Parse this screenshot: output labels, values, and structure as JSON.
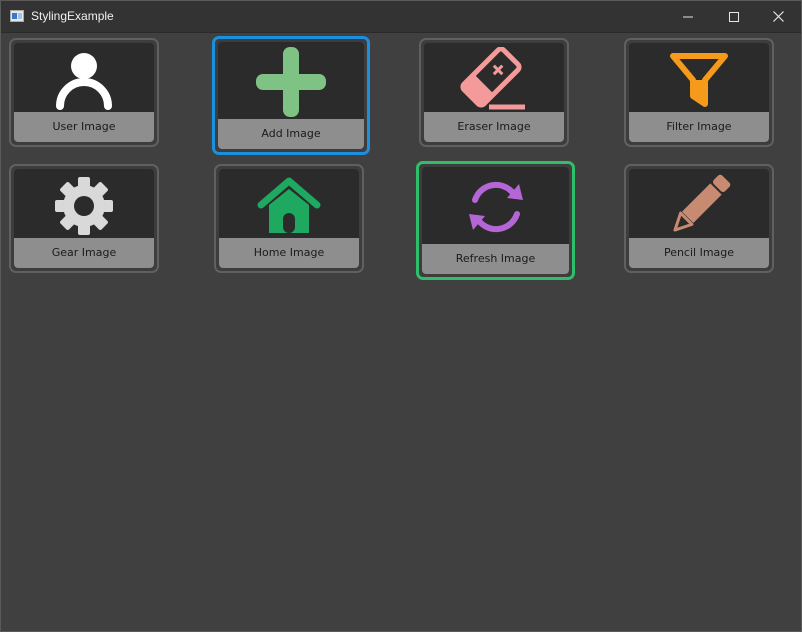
{
  "window": {
    "title": "StylingExample"
  },
  "tiles": [
    {
      "label": "User Image",
      "icon": "user-icon",
      "color": "#ffffff"
    },
    {
      "label": "Add Image",
      "icon": "plus-icon",
      "color": "#7ec384",
      "selected": "blue"
    },
    {
      "label": "Eraser Image",
      "icon": "eraser-icon",
      "color": "#f59a9a"
    },
    {
      "label": "Filter Image",
      "icon": "filter-icon",
      "color": "#f59a1a"
    },
    {
      "label": "Gear Image",
      "icon": "gear-icon",
      "color": "#d9d9d9"
    },
    {
      "label": "Home Image",
      "icon": "home-icon",
      "color": "#1ea860"
    },
    {
      "label": "Refresh Image",
      "icon": "refresh-icon",
      "color": "#b466d6",
      "selected": "green"
    },
    {
      "label": "Pencil Image",
      "icon": "pencil-icon",
      "color": "#c98a72"
    }
  ],
  "colors": {
    "selection_blue": "#1b8fe0",
    "selection_green": "#2fbf6a",
    "background": "#404040"
  }
}
